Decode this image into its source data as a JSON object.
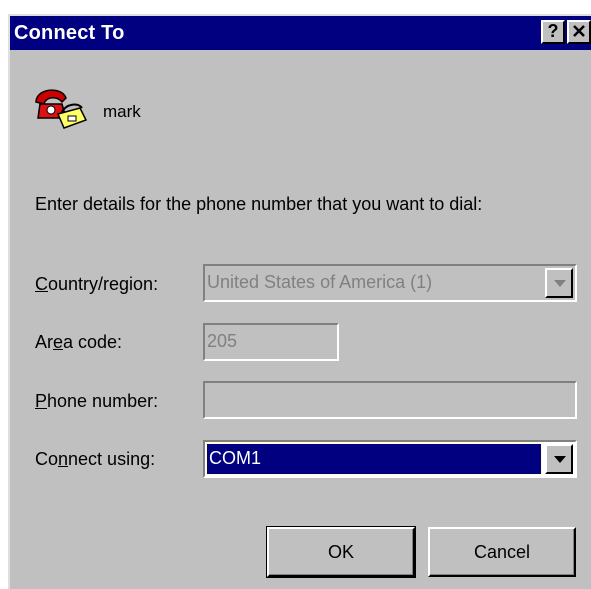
{
  "window": {
    "title": "Connect To",
    "help_button": "?",
    "close_button": "✕"
  },
  "entry": {
    "name": "mark",
    "icon": "phone-connection-icon"
  },
  "instructions": "Enter details for the phone number that you want to dial:",
  "form": {
    "country_label": {
      "pre": "",
      "key": "C",
      "post": "ountry/region:"
    },
    "country_value": "United States of America (1)",
    "area_label": {
      "pre": "Ar",
      "key": "e",
      "post": "a code:"
    },
    "area_value": "205",
    "phone_label": {
      "pre": "",
      "key": "P",
      "post": "hone number:"
    },
    "phone_value": "",
    "connect_label": {
      "pre": "Co",
      "key": "n",
      "post": "nect using:"
    },
    "connect_value": "COM1"
  },
  "buttons": {
    "ok": "OK",
    "cancel": "Cancel"
  },
  "colors": {
    "titlebar": "#000080",
    "face": "#c0c0c0",
    "selection": "#000080"
  }
}
